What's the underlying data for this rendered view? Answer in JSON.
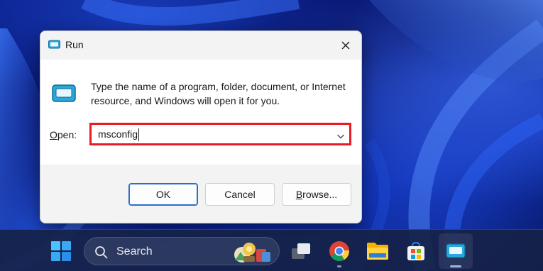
{
  "dialog": {
    "title": "Run",
    "description": "Type the name of a program, folder, document, or Internet resource, and Windows will open it for you.",
    "open_label_hotkey": "O",
    "open_label_rest": "pen:",
    "command_value": "msconfig",
    "buttons": {
      "ok": "OK",
      "cancel": "Cancel",
      "browse_hotkey": "B",
      "browse_rest": "rowse..."
    },
    "icons": {
      "title": "run-icon",
      "close": "close-icon",
      "dropdown": "chevron-down-icon"
    },
    "highlight_color": "#e81c24"
  },
  "taskbar": {
    "search_placeholder": "Search",
    "apps": [
      "start-icon",
      "search-icon",
      "task-view-icon",
      "chrome-icon",
      "file-explorer-icon",
      "microsoft-store-icon",
      "run-icon"
    ],
    "active_app": "run-icon"
  }
}
